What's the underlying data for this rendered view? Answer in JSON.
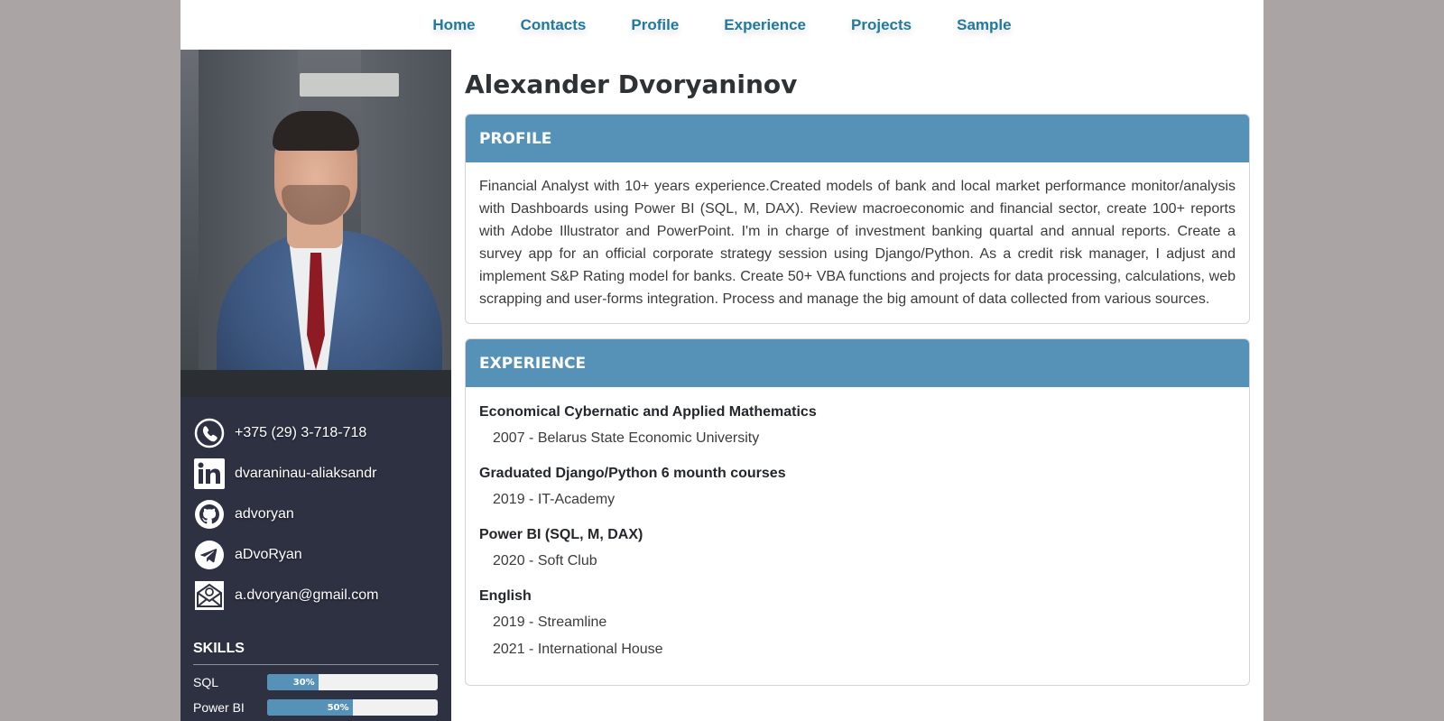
{
  "nav": [
    "Home",
    "Contacts",
    "Profile",
    "Experience",
    "Projects",
    "Sample"
  ],
  "name": "Alexander Dvoryaninov",
  "contacts": [
    {
      "icon": "phone-icon",
      "text": "+375 (29) 3-718-718"
    },
    {
      "icon": "linkedin-icon",
      "text": "dvaraninau-aliaksandr"
    },
    {
      "icon": "github-icon",
      "text": "advoryan"
    },
    {
      "icon": "telegram-icon",
      "text": "aDvoRyan"
    },
    {
      "icon": "email-icon",
      "text": "a.dvoryan@gmail.com"
    }
  ],
  "skills": {
    "title": "SKILLS",
    "items": [
      {
        "label": "SQL",
        "percent_label": "30%",
        "percent": 30
      },
      {
        "label": "Power BI",
        "percent_label": "50%",
        "percent": 50
      }
    ]
  },
  "profile": {
    "header": "PROFILE",
    "text": "Financial Analyst with 10+ years experience.Created models of bank and local market performance monitor/analysis with Dashboards using Power BI (SQL, M, DAX). Review macroeconomic and financial sector, create 100+ reports with Adobe Illustrator and PowerPoint. I'm in charge of investment banking quartal and annual reports. Create a survey app for an official corporate strategy session using Django/Python. As a credit risk manager, I adjust and implement S&P Rating model for banks. Create 50+ VBA functions and projects for data processing, calculations, web scrapping and user-forms integration. Process and manage the big amount of data collected from various sources."
  },
  "experience": {
    "header": "EXPERIENCE",
    "items": [
      {
        "title": "Economical Cybernatic and Applied Mathematics",
        "lines": [
          "2007 - Belarus State Economic University"
        ]
      },
      {
        "title": "Graduated Django/Python 6 mounth courses",
        "lines": [
          "2019 - IT-Academy"
        ]
      },
      {
        "title": "Power BI (SQL, M, DAX)",
        "lines": [
          "2020 - Soft Club"
        ]
      },
      {
        "title": "English",
        "lines": [
          "2019 - Streamline",
          "2021 - International House"
        ]
      }
    ]
  },
  "colors": {
    "accent": "#5691b8",
    "sidebar": "#2d3142",
    "nav_link": "#21799f",
    "backdrop": "#aaa4a4"
  }
}
